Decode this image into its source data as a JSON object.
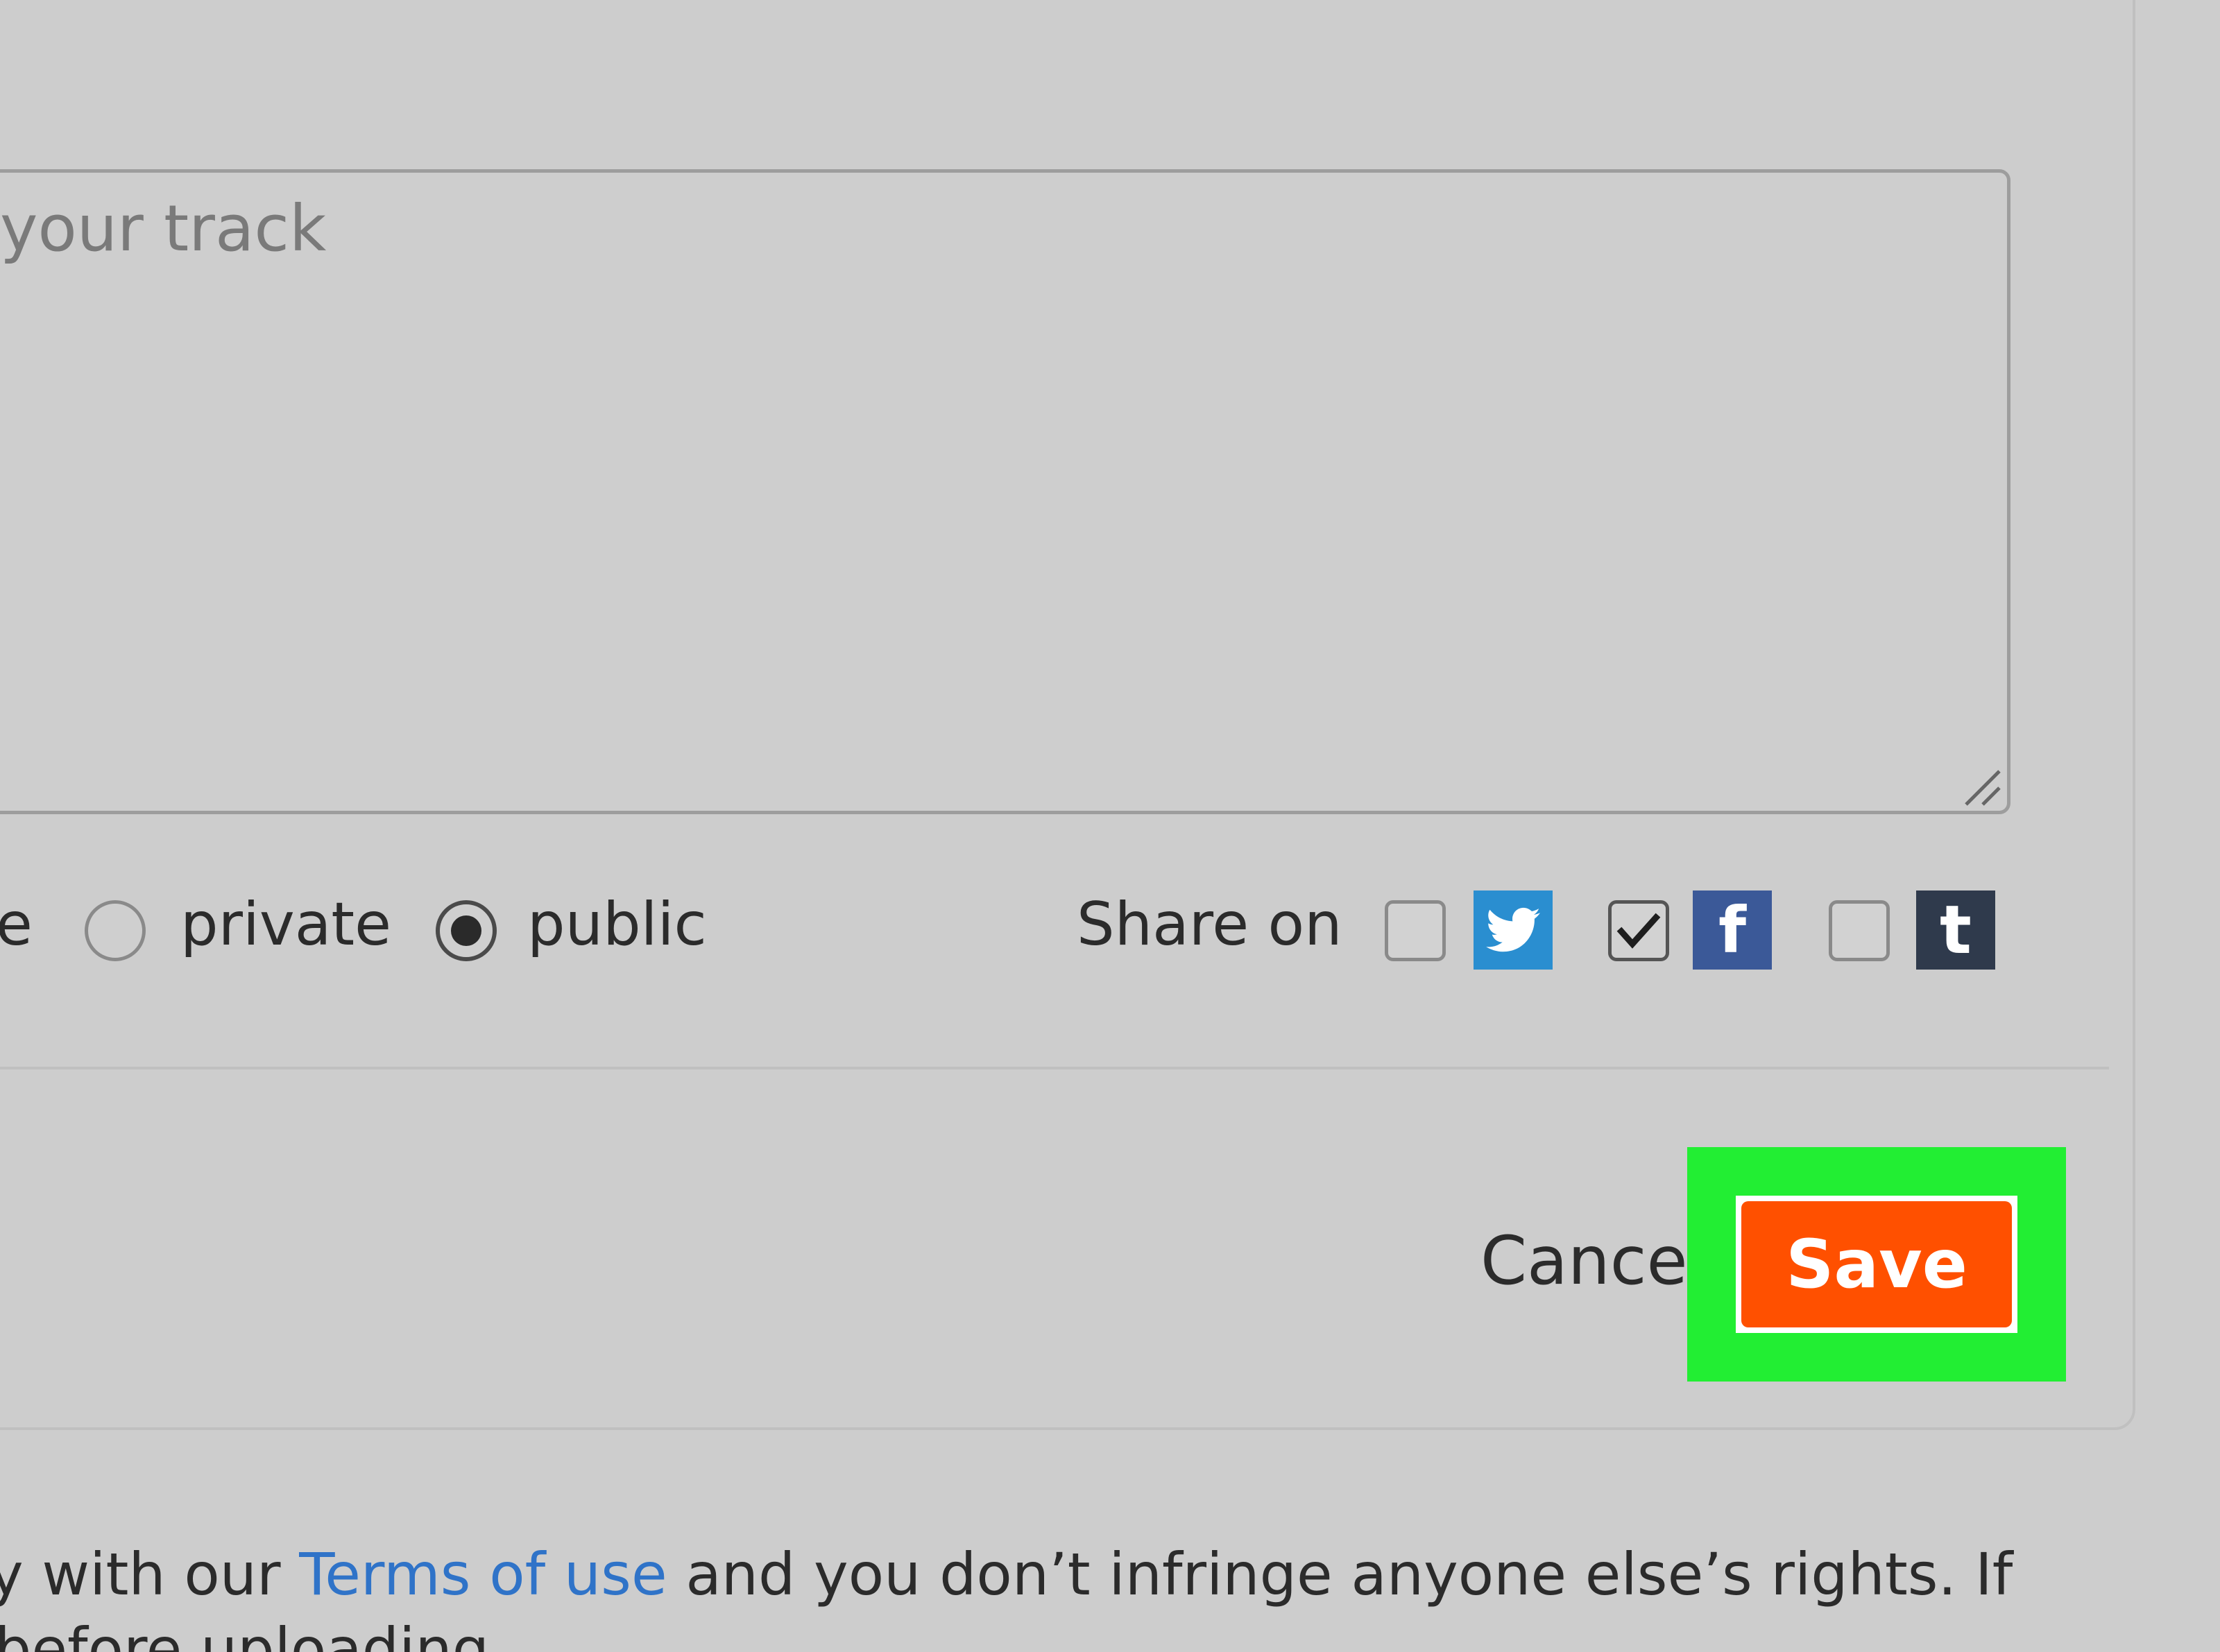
{
  "description": {
    "placeholder": "your track"
  },
  "privacy": {
    "label_fragment": "e",
    "options": [
      {
        "label": "private",
        "selected": false
      },
      {
        "label": "public",
        "selected": true
      }
    ]
  },
  "share": {
    "label": "Share on",
    "networks": [
      {
        "name": "twitter",
        "icon": "twitter-icon",
        "checked": false,
        "color": "#2a8ed0"
      },
      {
        "name": "facebook",
        "icon": "facebook-icon",
        "glyph": "f",
        "checked": true,
        "color": "#3b5998"
      },
      {
        "name": "tumblr",
        "icon": "tumblr-icon",
        "glyph": "t",
        "checked": false,
        "color": "#2f3a4c"
      }
    ]
  },
  "actions": {
    "cancel_label": "Cancel",
    "save_label": "Save",
    "save_color": "#ff5000",
    "highlight_color": "#22ee33"
  },
  "footer": {
    "prefix": "y with our ",
    "link_text": "Terms of use",
    "suffix": " and you don’t infringe anyone else’s rights. If",
    "line2": "before uploading."
  }
}
